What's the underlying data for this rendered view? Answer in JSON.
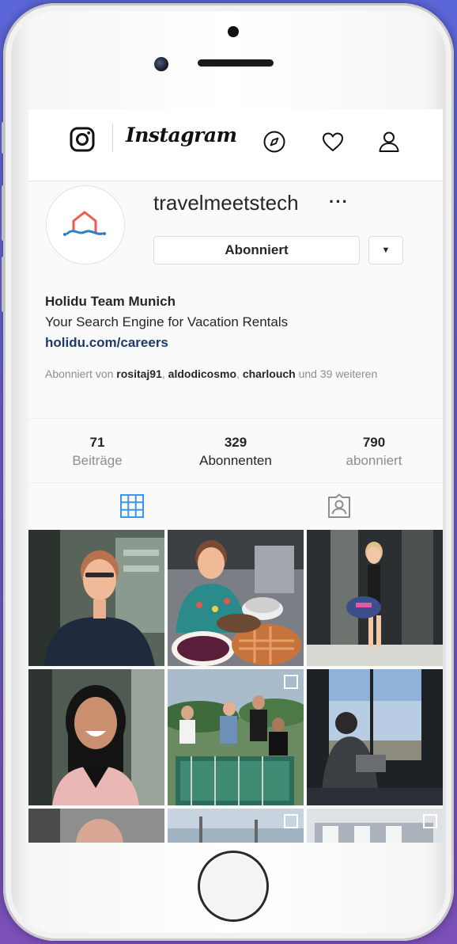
{
  "app": {
    "wordmark": "Instagram"
  },
  "icons": {
    "logo": "instagram-glyph-icon",
    "explore": "compass-icon",
    "activity": "heart-icon",
    "profile": "person-icon",
    "grid_tab": "grid-icon",
    "tagged_tab": "tagged-portrait-icon",
    "more": "more-dots-icon",
    "dropdown": "caret-down-icon"
  },
  "profile": {
    "username": "travelmeetstech",
    "more_label": "···",
    "follow_button_label": "Abonniert",
    "dropdown_label": "▼",
    "name": "Holidu Team Munich",
    "bio": "Your Search Engine for Vacation Rentals",
    "link": "holidu.com/careers",
    "followed_by": {
      "prefix": "Abonniert von ",
      "users": [
        "rositaj91",
        "aldodicosmo",
        "charlouch"
      ],
      "separator": ", ",
      "suffix": " und 39 weiteren"
    }
  },
  "stats": [
    {
      "value": "71",
      "label": "Beiträge"
    },
    {
      "value": "329",
      "label": "Abonnenten"
    },
    {
      "value": "790",
      "label": "abonniert"
    }
  ],
  "colors": {
    "background_top": "#5b66d8",
    "background_bottom": "#7a4fb8",
    "link": "#1e3a6b",
    "active_tab": "#3897f0",
    "muted_text": "#8e8e8e",
    "primary_text": "#262626"
  },
  "posts": [
    {
      "subject": "man-with-glasses-portrait"
    },
    {
      "subject": "woman-with-pies"
    },
    {
      "subject": "woman-with-bag-at-door"
    },
    {
      "subject": "smiling-woman-portrait"
    },
    {
      "subject": "team-at-foosball-table"
    },
    {
      "subject": "person-at-window-laptop"
    },
    {
      "subject": "partial-photo"
    },
    {
      "subject": "partial-photo"
    },
    {
      "subject": "partial-photo"
    }
  ]
}
